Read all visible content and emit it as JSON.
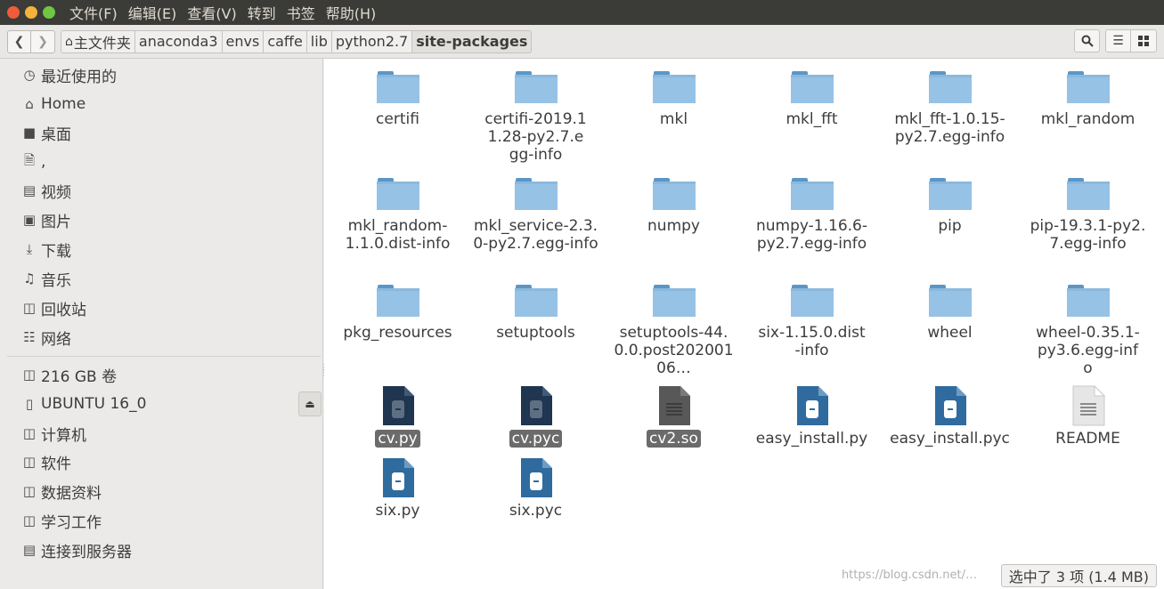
{
  "menubar": {
    "items": [
      "文件(F)",
      "编辑(E)",
      "查看(V)",
      "转到",
      "书签",
      "帮助(H)"
    ]
  },
  "toolbar": {
    "back_icon": "chevron-left-icon",
    "forward_icon": "chevron-right-icon",
    "home_icon": "home-icon",
    "breadcrumbs": [
      "主文件夹",
      "anaconda3",
      "envs",
      "caffe",
      "lib",
      "python2.7",
      "site-packages"
    ],
    "search_icon": "search-icon",
    "list_icon": "list-view-icon",
    "grid_icon": "grid-view-icon"
  },
  "sidebar": {
    "items": [
      {
        "label": "最近使用的",
        "icon": "clock-icon"
      },
      {
        "label": "Home",
        "icon": "home-icon"
      },
      {
        "label": "桌面",
        "icon": "folder-icon"
      },
      {
        "label": ",",
        "icon": "document-icon"
      },
      {
        "label": "视频",
        "icon": "film-icon"
      },
      {
        "label": "图片",
        "icon": "image-icon"
      },
      {
        "label": "下载",
        "icon": "download-icon"
      },
      {
        "label": "音乐",
        "icon": "music-icon"
      },
      {
        "label": "回收站",
        "icon": "trash-icon"
      },
      {
        "label": "网络",
        "icon": "network-icon"
      }
    ],
    "devices": [
      {
        "label": "216 GB 卷",
        "icon": "drive-icon"
      },
      {
        "label": "UBUNTU 16_0",
        "icon": "usb-icon"
      },
      {
        "label": "计算机",
        "icon": "drive-icon"
      },
      {
        "label": "软件",
        "icon": "drive-icon"
      },
      {
        "label": "数据资料",
        "icon": "drive-icon"
      },
      {
        "label": "学习工作",
        "icon": "drive-icon"
      },
      {
        "label": "连接到服务器",
        "icon": "server-icon"
      }
    ]
  },
  "files": {
    "row1": [
      "certifi",
      "certifi-2019.11.28-py2.7.egg-info",
      "mkl",
      "mkl_fft",
      "mkl_fft-1.0.15-py2.7.egg-info",
      "mkl_random"
    ],
    "row2": [
      "mkl_random-1.1.0.dist-info",
      "mkl_service-2.3.0-py2.7.egg-info",
      "numpy",
      "numpy-1.16.6-py2.7.egg-info",
      "pip",
      "pip-19.3.1-py2.7.egg-info"
    ],
    "row3": [
      "pkg_resources",
      "setuptools",
      "setuptools-44.0.0.post20200106…",
      "six-1.15.0.dist-info",
      "wheel",
      "wheel-0.35.1-py3.6.egg-info"
    ],
    "row4": [
      "cv.py",
      "cv.pyc",
      "cv2.so",
      "easy_install.py",
      "easy_install.pyc",
      "README"
    ],
    "row5": [
      "six.py",
      "six.pyc"
    ]
  },
  "status": {
    "text": "选中了 3 项 (1.4 MB)",
    "watermark": "https://blog.csdn.net/…"
  },
  "colors": {
    "folder": "#96c2e6",
    "python_file_light": "#2f6b9e",
    "python_file_dark": "#1f3550"
  }
}
